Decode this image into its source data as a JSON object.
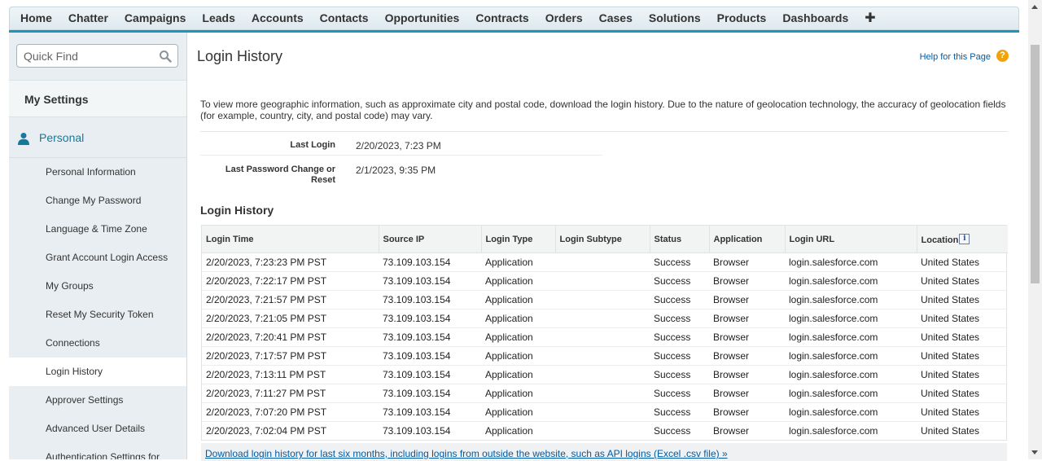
{
  "nav": {
    "tabs": [
      "Home",
      "Chatter",
      "Campaigns",
      "Leads",
      "Accounts",
      "Contacts",
      "Opportunities",
      "Contracts",
      "Orders",
      "Cases",
      "Solutions",
      "Products",
      "Dashboards"
    ],
    "plus_label": "✚"
  },
  "sidebar": {
    "quick_find_placeholder": "Quick Find",
    "my_settings": "My Settings",
    "personal": "Personal",
    "items": [
      {
        "label": "Personal Information"
      },
      {
        "label": "Change My Password"
      },
      {
        "label": "Language & Time Zone"
      },
      {
        "label": "Grant Account Login Access"
      },
      {
        "label": "My Groups"
      },
      {
        "label": "Reset My Security Token"
      },
      {
        "label": "Connections"
      },
      {
        "label": "Login History",
        "active": true
      },
      {
        "label": "Approver Settings"
      },
      {
        "label": "Advanced User Details"
      },
      {
        "label": "Authentication Settings for"
      }
    ]
  },
  "main": {
    "title": "Login History",
    "help_link": "Help for this Page",
    "help_icon": "?",
    "intro": "To view more geographic information, such as approximate city and postal code, download the login history. Due to the nature of geolocation technology, the accuracy of geolocation fields (for example, country, city, and postal code) may vary.",
    "last_login_label": "Last Login",
    "last_login_value": "2/20/2023, 7:23 PM",
    "last_pw_label": "Last Password Change or Reset",
    "last_pw_value": "2/1/2023, 9:35 PM",
    "section_title": "Login History",
    "table": {
      "headers": [
        "Login Time",
        "Source IP",
        "Login Type",
        "Login Subtype",
        "Status",
        "Application",
        "Login URL",
        "Location"
      ],
      "rows": [
        [
          "2/20/2023, 7:23:23 PM PST",
          "73.109.103.154",
          "Application",
          "",
          "Success",
          "Browser",
          "login.salesforce.com",
          "United States"
        ],
        [
          "2/20/2023, 7:22:17 PM PST",
          "73.109.103.154",
          "Application",
          "",
          "Success",
          "Browser",
          "login.salesforce.com",
          "United States"
        ],
        [
          "2/20/2023, 7:21:57 PM PST",
          "73.109.103.154",
          "Application",
          "",
          "Success",
          "Browser",
          "login.salesforce.com",
          "United States"
        ],
        [
          "2/20/2023, 7:21:05 PM PST",
          "73.109.103.154",
          "Application",
          "",
          "Success",
          "Browser",
          "login.salesforce.com",
          "United States"
        ],
        [
          "2/20/2023, 7:20:41 PM PST",
          "73.109.103.154",
          "Application",
          "",
          "Success",
          "Browser",
          "login.salesforce.com",
          "United States"
        ],
        [
          "2/20/2023, 7:17:57 PM PST",
          "73.109.103.154",
          "Application",
          "",
          "Success",
          "Browser",
          "login.salesforce.com",
          "United States"
        ],
        [
          "2/20/2023, 7:13:11 PM PST",
          "73.109.103.154",
          "Application",
          "",
          "Success",
          "Browser",
          "login.salesforce.com",
          "United States"
        ],
        [
          "2/20/2023, 7:11:27 PM PST",
          "73.109.103.154",
          "Application",
          "",
          "Success",
          "Browser",
          "login.salesforce.com",
          "United States"
        ],
        [
          "2/20/2023, 7:07:20 PM PST",
          "73.109.103.154",
          "Application",
          "",
          "Success",
          "Browser",
          "login.salesforce.com",
          "United States"
        ],
        [
          "2/20/2023, 7:02:04 PM PST",
          "73.109.103.154",
          "Application",
          "",
          "Success",
          "Browser",
          "login.salesforce.com",
          "United States"
        ]
      ]
    },
    "download_link": "Download login history for last six months, including logins from outside the website, such as API logins (Excel .csv file) »"
  },
  "colors": {
    "accent": "#1797c0",
    "link": "#015ba7",
    "sidebar_bg": "#e8eef1"
  }
}
